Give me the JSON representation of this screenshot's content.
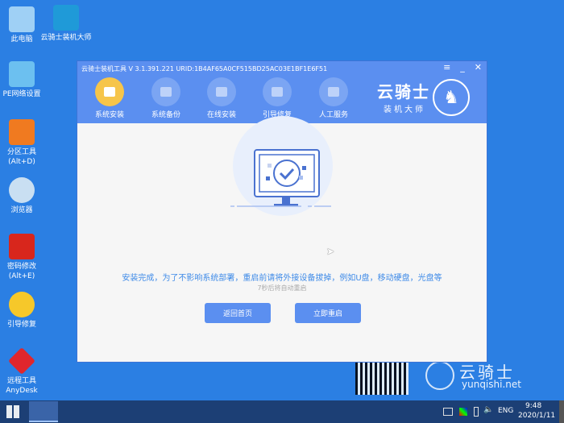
{
  "desktop": {
    "icons": [
      {
        "label": "此电脑",
        "color": "#9fd0f5"
      },
      {
        "label": "云骑士装机大师",
        "color": "#1f9ad8"
      },
      {
        "label": "PE网络设置",
        "color": "#6cc0f0"
      },
      {
        "label": "分区工具\n(Alt+D)",
        "color": "#f07a20"
      },
      {
        "label": "浏览器",
        "color": "#c9dff2"
      },
      {
        "label": "密码修改\n(Alt+E)",
        "color": "#d8261c"
      },
      {
        "label": "引导修复",
        "color": "#f6c82a"
      },
      {
        "label": "远程工具\nAnyDesk",
        "color": "#e0262c"
      }
    ],
    "watermark": {
      "brand": "云骑士",
      "url": "yunqishi.net"
    }
  },
  "window": {
    "title": "云骑士装机工具 V 3.1.391.221 URID:1B4AF65A0CF515BD25AC03E1BF1E6F51",
    "controls": [
      "≡",
      "_",
      "✕"
    ],
    "tabs": [
      {
        "label": "系统安装",
        "active": true
      },
      {
        "label": "系统备份"
      },
      {
        "label": "在线安装"
      },
      {
        "label": "引导修复"
      },
      {
        "label": "人工服务"
      }
    ],
    "logo": {
      "name": "云骑士",
      "subtitle": "装机大师"
    },
    "message": "安装完成，为了不影响系统部署，重启前请将外接设备拔掉，例如U盘，移动硬盘，光盘等",
    "countdown": "7秒后将自动重启",
    "back_button": "返回首页",
    "restart_button": "立即重启"
  },
  "taskbar": {
    "lang": "ENG",
    "time": "9:48",
    "date": "2020/1/11"
  }
}
